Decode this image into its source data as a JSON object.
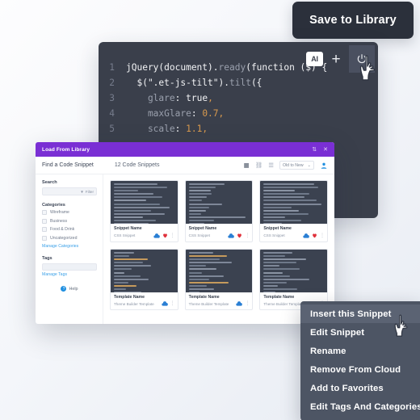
{
  "save_pill": {
    "label": "Save to Library"
  },
  "editor": {
    "toolbar": {
      "ai_label": "AI",
      "plus_label": "+",
      "code_toggle_name": "code-toggle"
    },
    "lines": [
      {
        "num": "1",
        "tokens": [
          {
            "t": "jQuery(document).",
            "c": "w"
          },
          {
            "t": "ready",
            "c": "g"
          },
          {
            "t": "(function ($) {",
            "c": "w"
          }
        ]
      },
      {
        "num": "2",
        "tokens": [
          {
            "t": "  $(\".et-js-tilt\").",
            "c": "w"
          },
          {
            "t": "tilt",
            "c": "g"
          },
          {
            "t": "({",
            "c": "w"
          }
        ]
      },
      {
        "num": "3",
        "tokens": [
          {
            "t": "    glare",
            "c": "g"
          },
          {
            "t": ": ",
            "c": "w"
          },
          {
            "t": "true",
            "c": "w"
          },
          {
            "t": ",",
            "c": "o"
          }
        ]
      },
      {
        "num": "4",
        "tokens": [
          {
            "t": "    maxGlare",
            "c": "g"
          },
          {
            "t": ": ",
            "c": "w"
          },
          {
            "t": "0.7",
            "c": "o"
          },
          {
            "t": ",",
            "c": "o"
          }
        ]
      },
      {
        "num": "5",
        "tokens": [
          {
            "t": "    scale",
            "c": "g"
          },
          {
            "t": ": ",
            "c": "w"
          },
          {
            "t": "1.1",
            "c": "o"
          },
          {
            "t": ",",
            "c": "o"
          }
        ]
      }
    ]
  },
  "modal": {
    "title": "Load From Library",
    "header_icons": {
      "expand": "⇅",
      "close": "✕"
    },
    "subbar": {
      "find_label": "Find a Code Snippet",
      "count_label": "12 Code Snippets",
      "view_grid": "▦",
      "view_link": "⛓",
      "view_list": "☰",
      "sort_value": "Old to New",
      "sort_caret": "⌄",
      "avatar": "account-icon"
    },
    "sidebar": {
      "search_label": "Search",
      "filter_label": "Filter",
      "categories_label": "Categories",
      "categories": [
        {
          "label": "Wireframe"
        },
        {
          "label": "Business"
        },
        {
          "label": "Food & Drink"
        },
        {
          "label": "Uncategorized"
        }
      ],
      "manage_categories": "Manage Categories",
      "tags_label": "Tags",
      "manage_tags": "Manage Tags",
      "help_label": "Help",
      "help_glyph": "?"
    },
    "cards": [
      {
        "name": "Snippet Name",
        "type": "CSS Snippet",
        "cloud": true,
        "heart": true
      },
      {
        "name": "Snippet Name",
        "type": "CSS Snippet",
        "cloud": true,
        "heart": true
      },
      {
        "name": "Snippet Name",
        "type": "CSS Snippet",
        "cloud": true,
        "heart": true
      },
      {
        "name": "Template Name",
        "type": "Theme Builder Template",
        "cloud": true,
        "heart": false
      },
      {
        "name": "Template Name",
        "type": "Theme Builder Template",
        "cloud": true,
        "heart": false
      },
      {
        "name": "Template Name",
        "type": "Theme Builder Template",
        "cloud": true,
        "heart": false
      }
    ]
  },
  "context_menu": {
    "items": [
      {
        "label": "Insert this Snippet",
        "selected": true
      },
      {
        "label": "Edit Snippet",
        "selected": false
      },
      {
        "label": "Rename",
        "selected": false
      },
      {
        "label": "Remove From Cloud",
        "selected": false
      },
      {
        "label": "Add to Favorites",
        "selected": false
      },
      {
        "label": "Edit Tags And Categories",
        "selected": false
      }
    ]
  },
  "colors": {
    "accent_purple": "#7a2fd4",
    "dark_panel": "#3a3f4b",
    "menu_bg": "#4d5564",
    "link_blue": "#3aa0e8",
    "heart_red": "#e0323c",
    "cloud_blue": "#2a7fd4",
    "code_orange": "#d99a4e"
  }
}
